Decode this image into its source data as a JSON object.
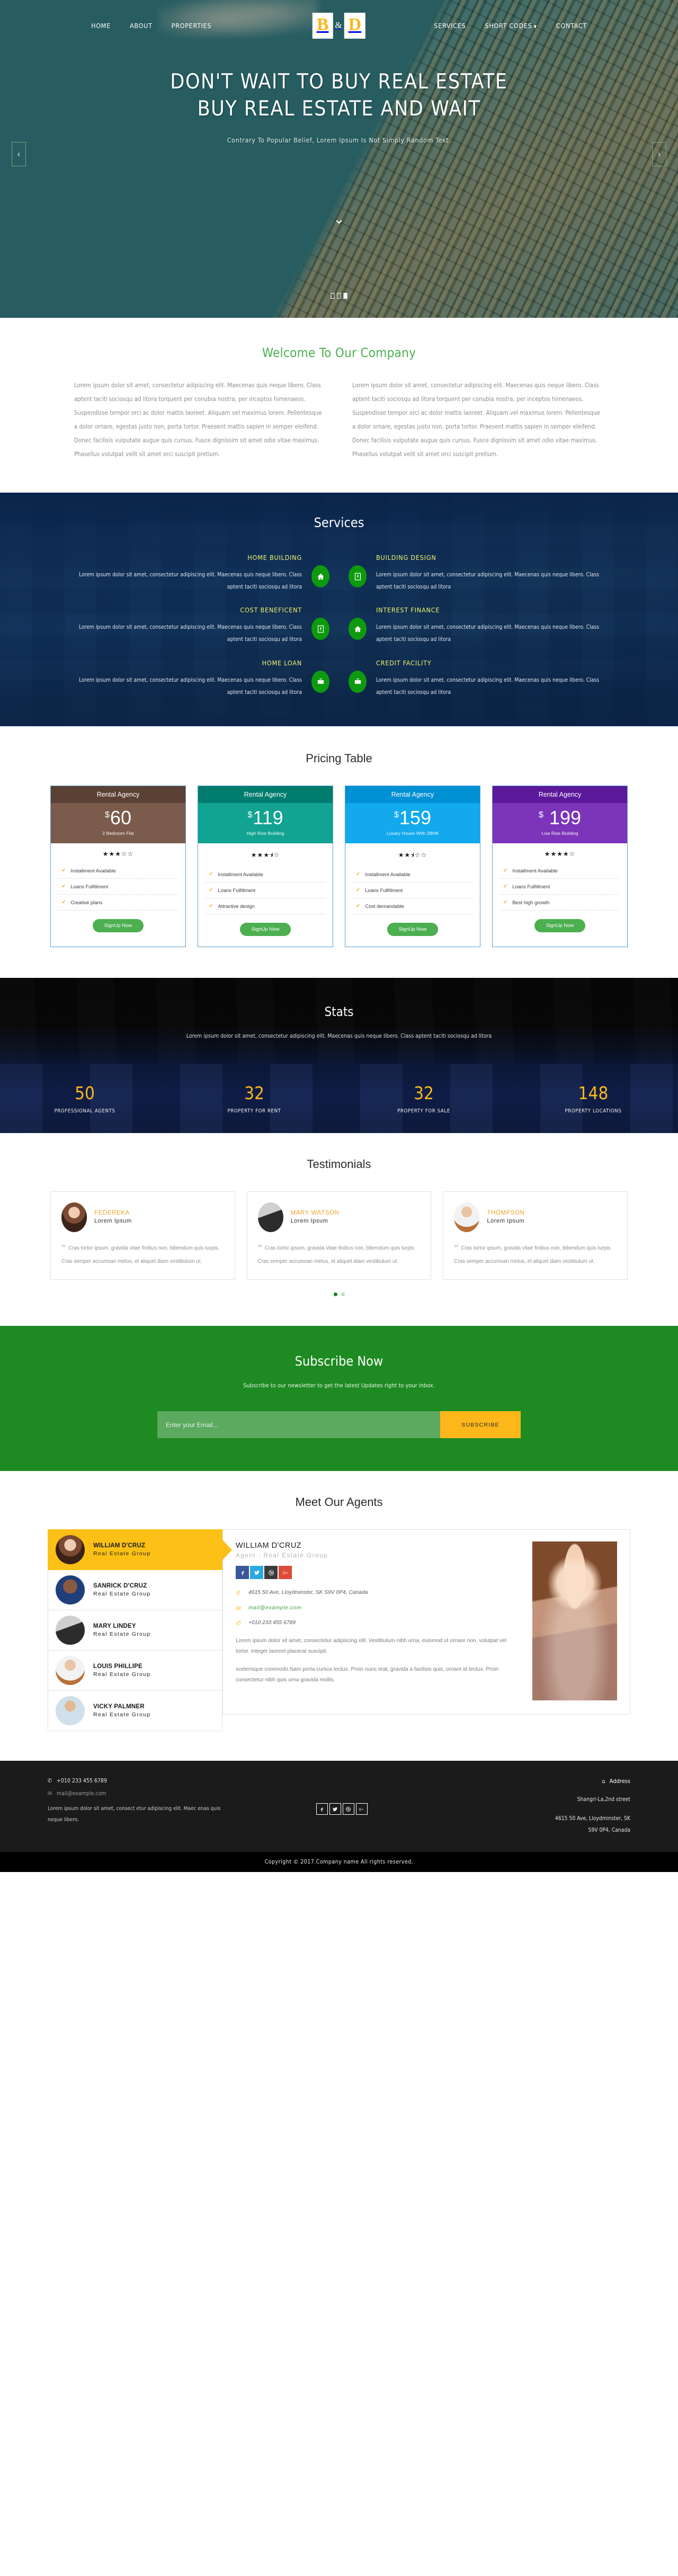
{
  "nav": {
    "left_items": [
      {
        "label": "HOME"
      },
      {
        "label": "ABOUT"
      },
      {
        "label": "PROPERTIES"
      }
    ],
    "right_items": [
      {
        "label": "SERVICES",
        "caret": ""
      },
      {
        "label": "SHORT CODES",
        "caret": "▼"
      },
      {
        "label": "CONTACT",
        "caret": ""
      }
    ],
    "logo": {
      "left": "B",
      "amp": "&",
      "right": "D"
    }
  },
  "hero": {
    "title_line1": "DON'T WAIT TO BUY REAL ESTATE",
    "title_line2": "BUY REAL ESTATE AND WAIT",
    "subtitle": "Contrary To Popular Belief, Lorem Ipsum Is Not Simply Random Text.",
    "prev": "‹",
    "next": "›",
    "scroll_arrow": "⌄"
  },
  "welcome": {
    "title": "Welcome To Our Company",
    "paragraph_left": "Lorem ipsum dolor sit amet, consectetur adipiscing elit. Maecenas quis neque libero. Class aptent taciti sociosqu ad litora torquent per conubia nostra, per inceptos himenaeos. Suspendisse tempor orci ac dolor mattis laoreet. Aliquam vel maximus lorem. Pellentesque a dolor ornare, egestas justo non, porta tortor. Praesent mattis sapien in semper eleifend. Donec facilisis vulputate augue quis cursus. Fusce dignissim sit amet odio vitae maximus. Phasellus volutpat velit sit amet orci suscipit pretium.",
    "paragraph_right": "Lorem ipsum dolor sit amet, consectetur adipiscing elit. Maecenas quis neque libero. Class aptent taciti sociosqu ad litora torquent per conubia nostra, per inceptos himenaeos. Suspendisse tempor orci ac dolor mattis laoreet. Aliquam vel maximus lorem. Pellentesque a dolor ornare, egestas justo non, porta tortor. Praesent mattis sapien in semper eleifend. Donec facilisis vulputate augue quis cursus. Fusce dignissim sit amet odio vitae maximus. Phasellus volutpat velit sit amet orci suscipit pretium."
  },
  "services": {
    "title": "Services",
    "items": [
      {
        "name": "HOME BUILDING",
        "icon": "home-icon",
        "desc": "Lorem ipsum dolor sit amet, consectetur adipiscing elit. Maecenas quis neque libero. Class aptent taciti sociosqu ad litora"
      },
      {
        "name": "BUILDING DESIGN",
        "icon": "pen-icon",
        "desc": "Lorem ipsum dolor sit amet, consectetur adipiscing elit. Maecenas quis neque libero. Class aptent taciti sociosqu ad litora"
      },
      {
        "name": "COST BENEFICENT",
        "icon": "pen-icon",
        "desc": "Lorem ipsum dolor sit amet, consectetur adipiscing elit. Maecenas quis neque libero. Class aptent taciti sociosqu ad litora"
      },
      {
        "name": "INTEREST FINANCE",
        "icon": "home-icon",
        "desc": "Lorem ipsum dolor sit amet, consectetur adipiscing elit. Maecenas quis neque libero. Class aptent taciti sociosqu ad litora"
      },
      {
        "name": "HOME LOAN",
        "icon": "briefcase-icon",
        "desc": "Lorem ipsum dolor sit amet, consectetur adipiscing elit. Maecenas quis neque libero. Class aptent taciti sociosqu ad litora"
      },
      {
        "name": "CREDIT FACILITY",
        "icon": "briefcase-icon",
        "desc": "Lorem ipsum dolor sit amet, consectetur adipiscing elit. Maecenas quis neque libero. Class aptent taciti sociosqu ad litora"
      }
    ]
  },
  "pricing": {
    "title": "Pricing Table",
    "cta_label": "SignUp Now",
    "cards": [
      {
        "head": "Rental Agency",
        "currency": "$",
        "amount": "60",
        "plan": "2 Bedroom Flat",
        "head_color": "#5b4035",
        "body_color": "#7b5b4c",
        "stars": "★★★☆☆",
        "rating": 3,
        "features": [
          "Installment Available",
          "Loans Fulfillment",
          "Creative plans"
        ]
      },
      {
        "head": "Rental Agency",
        "currency": "$",
        "amount": "119",
        "plan": "High Rise Building",
        "head_color": "#007c6e",
        "body_color": "#12a392",
        "stars": "★★★⯨☆",
        "rating": 3.5,
        "features": [
          "Installment Available",
          "Loans Fulfillment",
          "Attractive design"
        ]
      },
      {
        "head": "Rental Agency",
        "currency": "$",
        "amount": "159",
        "plan": "Luxary House With 2BHK",
        "head_color": "#0090d4",
        "body_color": "#12a9ed",
        "stars": "★★⯨☆☆",
        "rating": 2.5,
        "features": [
          "Installment Available",
          "Loans Fulfillment",
          "Cost demandable"
        ]
      },
      {
        "head": "Rental Agency",
        "currency": "$",
        "amount": "199",
        "plan": "Low Rise Building",
        "head_color": "#5b189b",
        "body_color": "#7b34ba",
        "stars": "★★★★☆",
        "rating": 4,
        "features": [
          "Installment Available",
          "Loans Fulfillment",
          "Best high growth"
        ]
      }
    ]
  },
  "stats": {
    "title": "Stats",
    "subtitle": "Lorem ipsum dolor sit amet, consectetur adipiscing elit. Maecenas quis neque libero. Class aptent taciti sociosqu ad litora",
    "items": [
      {
        "value": "50",
        "label": "PROFESSIONAL AGENTS"
      },
      {
        "value": "32",
        "label": "PROPERTY FOR RENT"
      },
      {
        "value": "32",
        "label": "PROPERTY FOR SALE"
      },
      {
        "value": "148",
        "label": "PROPERTY LOCATIONS"
      }
    ]
  },
  "testimonials": {
    "title": "Testimonials",
    "quote_mark": "❞",
    "items": [
      {
        "name": "FEDEREKA",
        "role": "Lorem Ipsum",
        "text": "Cras tortor ipsum, gravida vitae finibus non, bibendum quis turpis. Cras semper accumsan metus, et aliquet diam vestibulum ut."
      },
      {
        "name": "MARY WATSON",
        "role": "Lorem Ipsum",
        "text": "Cras tortor ipsum, gravida vitae finibus non, bibendum quis turpis. Cras semper accumsan metus, et aliquet diam vestibulum ut."
      },
      {
        "name": "THOMPSON",
        "role": "Lorem Ipsum",
        "text": "Cras tortor ipsum, gravida vitae finibus non, bibendum quis turpis. Cras semper accumsan metus, et aliquet diam vestibulum ut."
      }
    ]
  },
  "subscribe": {
    "title": "Subscribe Now",
    "text": "Subscribe to our newsletter to get the latest Updates right to your inbox.",
    "placeholder": "Enter your Email...",
    "button": "SUBSCRIBE"
  },
  "agents": {
    "title": "Meet Our Agents",
    "list": [
      {
        "name": "WILLIAM D'CRUZ",
        "role": "Real Estate Group",
        "active": true
      },
      {
        "name": "SANRICK D'CRUZ",
        "role": "Real Estate Group",
        "active": false
      },
      {
        "name": "MARY LINDEY",
        "role": "Real Estate Group",
        "active": false
      },
      {
        "name": "LOUIS PHILLIPE",
        "role": "Real Estate Group",
        "active": false
      },
      {
        "name": "VICKY PALMNER",
        "role": "Real Estate Group",
        "active": false
      }
    ],
    "detail": {
      "name": "WILLIAM D'CRUZ",
      "role": "Agent : Real Estate Group",
      "address": "4615 50 Ave, Lloydminster, SK S9V 0P4, Canada",
      "email": "mail@example.com",
      "phone": "+010 233 455 6789",
      "para1": "Lorem ipsum dolor sit amet, consectetur adipiscing elit. Vestibulum nibh urna, euismod ut ornare non, volutpat vel tortor. Integer laoreet placerat suscipit.",
      "para2": "scelerisque commodo.Nam porta cursus lectus. Proin nunc erat, gravida a facilisis quis, ornare id lectus. Proin consectetur nibh quis urna gravida mollis.",
      "socials": [
        {
          "name": "facebook",
          "glyph": "f"
        },
        {
          "name": "twitter",
          "glyph": "t"
        },
        {
          "name": "dribbble",
          "glyph": "d"
        },
        {
          "name": "googleplus",
          "glyph": "G+"
        }
      ]
    }
  },
  "footer": {
    "phone": "+010 233 455 6789",
    "email": "mail@example.com",
    "description": "Lorem ipsum dolor sit amet, consect etur adipiscing elit. Maec enas quis neque libero.",
    "address_head": "Address",
    "address_line1": "Shangri-La,2nd street",
    "address_line2": "4615 50 Ave, Lloydminster, SK",
    "address_line3": "S9V 0P4, Canada",
    "socials": [
      {
        "name": "facebook",
        "glyph": "f"
      },
      {
        "name": "twitter",
        "glyph": "t"
      },
      {
        "name": "dribbble",
        "glyph": "d"
      },
      {
        "name": "googleplus",
        "glyph": "G+"
      }
    ],
    "copyright": "Copyright © 2017.Company name All rights reserved."
  }
}
